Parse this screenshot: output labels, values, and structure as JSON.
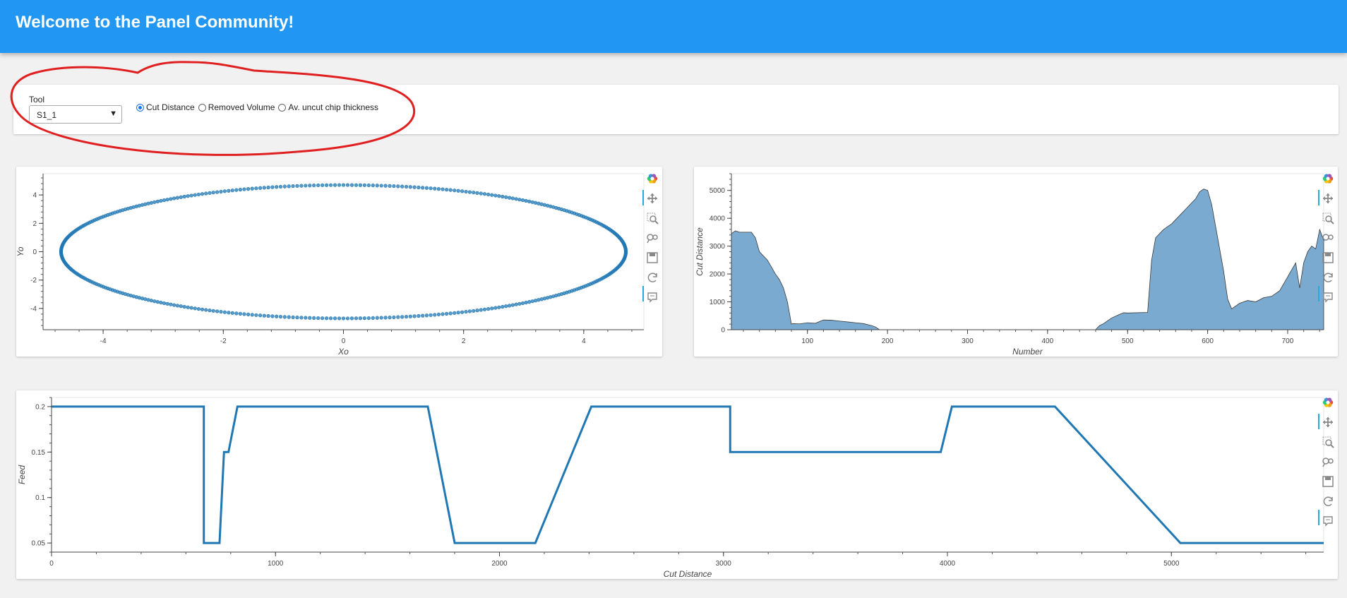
{
  "header": {
    "title": "Welcome to the Panel Community!"
  },
  "controls": {
    "tool_label": "Tool",
    "tool_value": "S1_1",
    "radios": [
      {
        "label": "Cut Distance",
        "checked": true
      },
      {
        "label": "Removed Volume",
        "checked": false
      },
      {
        "label": "Av. uncut chip thickness",
        "checked": false
      }
    ]
  },
  "toolbar_icons": [
    "bokeh-logo-icon",
    "pan-icon",
    "box-zoom-icon",
    "wheel-zoom-icon",
    "save-icon",
    "reset-icon",
    "hover-icon"
  ],
  "colors": {
    "header": "#2196f3",
    "series": "#1f77b4",
    "area_fill": "#7aaad0",
    "annotation": "#e02020"
  },
  "chart_data": [
    {
      "type": "scatter",
      "xlabel": "Xo",
      "ylabel": "Yo",
      "xlim": [
        -5,
        5
      ],
      "ylim": [
        -5.5,
        5.5
      ],
      "xticks": [
        -4,
        -2,
        0,
        2,
        4
      ],
      "yticks": [
        -4,
        -2,
        0,
        2,
        4
      ],
      "shape": "ellipse",
      "center": [
        0,
        0
      ],
      "rx": 4.7,
      "ry": 4.7
    },
    {
      "type": "area",
      "xlabel": "Number",
      "ylabel": "Cut Distance",
      "xlim": [
        5,
        745
      ],
      "ylim": [
        0,
        5600
      ],
      "xticks": [
        100,
        200,
        300,
        400,
        500,
        600,
        700
      ],
      "yticks": [
        0,
        1000,
        2000,
        3000,
        4000,
        5000
      ],
      "x": [
        5,
        10,
        15,
        30,
        35,
        40,
        50,
        60,
        65,
        70,
        75,
        80,
        82,
        90,
        100,
        110,
        120,
        130,
        140,
        150,
        160,
        170,
        180,
        185,
        190,
        460,
        465,
        470,
        480,
        490,
        495,
        500,
        525,
        530,
        535,
        545,
        555,
        565,
        575,
        585,
        590,
        595,
        600,
        605,
        610,
        620,
        625,
        630,
        640,
        650,
        660,
        670,
        680,
        690,
        700,
        710,
        715,
        720,
        725,
        730,
        735,
        740,
        745
      ],
      "values": [
        3450,
        3550,
        3500,
        3500,
        3300,
        2800,
        2500,
        2000,
        1800,
        1500,
        1000,
        200,
        220,
        210,
        250,
        230,
        350,
        340,
        310,
        280,
        250,
        220,
        150,
        100,
        0,
        0,
        150,
        220,
        420,
        550,
        610,
        600,
        620,
        2500,
        3300,
        3600,
        3800,
        4100,
        4400,
        4700,
        4950,
        5050,
        5000,
        4500,
        3700,
        2100,
        1100,
        750,
        950,
        1050,
        1000,
        1150,
        1200,
        1400,
        1900,
        2400,
        1500,
        2400,
        2800,
        3000,
        2900,
        3600,
        3200
      ]
    },
    {
      "type": "line",
      "xlabel": "Cut Distance",
      "ylabel": "Feed",
      "xlim": [
        0,
        5680
      ],
      "ylim": [
        0.04,
        0.21
      ],
      "xticks": [
        0,
        1000,
        2000,
        3000,
        4000,
        5000
      ],
      "yticks": [
        0.05,
        0.1,
        0.15,
        0.2
      ],
      "ytick_labels": [
        "0.05",
        "0.1",
        "0.15",
        "0.2"
      ],
      "x": [
        0,
        680,
        680,
        750,
        770,
        790,
        830,
        1680,
        1800,
        2160,
        2410,
        3030,
        3030,
        3970,
        4020,
        4480,
        5040,
        5680
      ],
      "values": [
        0.2,
        0.2,
        0.05,
        0.05,
        0.15,
        0.15,
        0.2,
        0.2,
        0.05,
        0.05,
        0.2,
        0.2,
        0.15,
        0.15,
        0.2,
        0.2,
        0.05,
        0.05
      ]
    }
  ]
}
